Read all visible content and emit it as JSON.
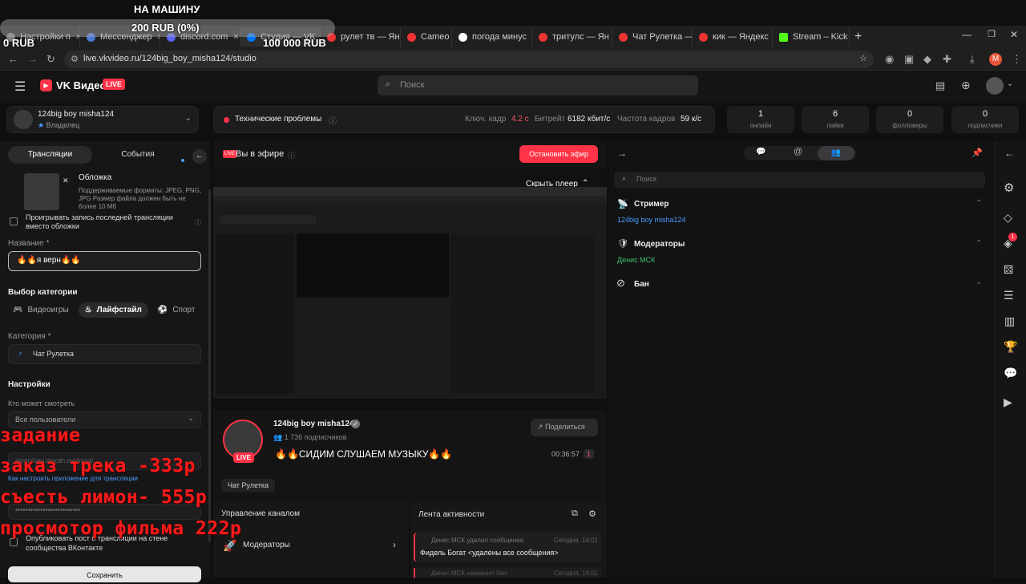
{
  "overlay": {
    "goal_title": "НА МАШИНУ",
    "goal_progress": "200 RUB (0%)",
    "goal_min": "0 RUB",
    "goal_max": "100 000 RUB",
    "task_lines": [
      "задание",
      "заказ трека -333р",
      "съесть лимон- 555р",
      "просмотор фильма 222р"
    ]
  },
  "browser": {
    "tabs": [
      "Настройки п",
      "Мессенджер",
      "discord.com",
      "Студия — VK",
      "рулет тв — Ян",
      "Cameo",
      "погода минус",
      "тритулс — Ян",
      "Чат Рулетка —",
      "кик — Яндекс",
      "Stream – Kick Dashboard"
    ],
    "url": "live.vkvideo.ru/124big_boy_misha124/studio",
    "profile_letter": "M"
  },
  "app": {
    "logo_text": "VK Видео",
    "logo_badge": "LIVE",
    "search_placeholder": "Поиск"
  },
  "channel": {
    "name": "124big boy misha124",
    "role": "Владелец"
  },
  "status": {
    "problem": "Технические проблемы",
    "keyframe_label": "Ключ. кадр",
    "keyframe_value": "4.2 с",
    "bitrate_label": "Битрейт",
    "bitrate_value": "6182 кбит/с",
    "fps_label": "Частота кадров",
    "fps_value": "59 к/с"
  },
  "stats": [
    {
      "value": "1",
      "label": "онлайн"
    },
    {
      "value": "6",
      "label": "лайки"
    },
    {
      "value": "0",
      "label": "фолловеры"
    },
    {
      "value": "0",
      "label": "подписчики"
    }
  ],
  "left": {
    "tab_broadcasts": "Трансляции",
    "tab_events": "События",
    "cover_title": "Обложка",
    "cover_hint": "Поддерживаемые форматы: JPEG, PNG, JPG Размер файла должен быть не более 10 Мб",
    "replay_checkbox": "Проигрывать запись последней трансляции вместо обложки",
    "name_label": "Название *",
    "name_value": "🔥🔥я верн🔥🔥",
    "category_choice_label": "Выбор категории",
    "cat_games": "Видеоигры",
    "cat_lifestyle": "Лайфстайл",
    "cat_sport": "Спорт",
    "category_label": "Категория *",
    "category_value": "Чат Рулетка",
    "settings_label": "Настройки",
    "who_can_watch_label": "Кто может смотреть",
    "who_can_watch_value": "Все пользователи",
    "stream_url_value": "stmp://vsu.mycdn.me/input/",
    "setup_link": "Как настроить приложение для трансляции",
    "key_masked": "**************************",
    "publish_checkbox": "Опубликовать пост о трансляции на стене сообщества ВКонтакте",
    "save_button": "Сохранить"
  },
  "center": {
    "live_label": "Вы в эфире",
    "stop_button": "Остановить эфир",
    "hide_player": "Скрыть плеер",
    "streamer_name": "124big boy misha124",
    "subscribers": "1 736 подписчиков",
    "share_button": "Поделиться",
    "stream_title": "🔥🔥СИДИМ СЛУШАЕМ МУЗЫКУ🔥🔥",
    "duration": "00:36:57",
    "viewers": "1",
    "avatar_badge": "LIVE",
    "category_tag": "Чат Рулетка",
    "manage_label": "Управление каналом",
    "moderators_item": "Модераторы",
    "activity_label": "Лента активности",
    "activity": [
      {
        "user": "Денис МСК",
        "action": "удалил сообщения",
        "time": "Сегодня, 14:01",
        "target": "Фидель Богат",
        "detail": "<удалены все сообщения>"
      },
      {
        "user": "Денис МСК",
        "action": "назначил бан",
        "time": "Сегодня, 14:01"
      }
    ]
  },
  "right": {
    "search_placeholder": "Поиск",
    "streamer_section": "Стример",
    "streamer_name": "124big boy misha124",
    "moderators_section": "Модераторы",
    "moderator_name": "Денис МСК",
    "ban_section": "Бан",
    "rail_badge": "1"
  },
  "colors": {
    "accent": "#ff3347",
    "link": "#4a9eff",
    "moderator": "#3ec46d"
  }
}
